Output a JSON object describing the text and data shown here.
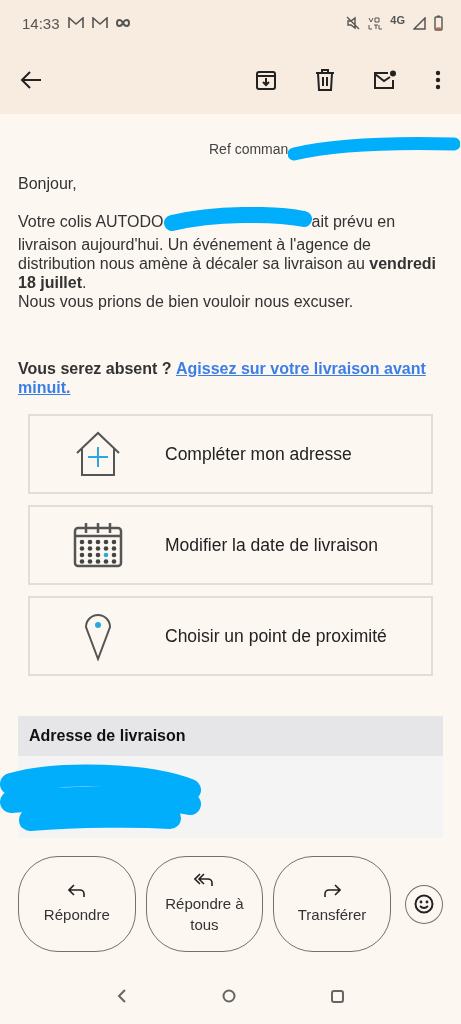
{
  "status_bar": {
    "time": "14:33",
    "network": "4G"
  },
  "body": {
    "reference": "Ref comman",
    "greeting": "Bonjour,",
    "intro_start": "Votre colis AUTODO",
    "intro_mid": "ait prévu en",
    "intro_end": "livraison aujourd'hui. Un événement à l'agence de distribution nous amène à décaler sa livraison au **vendredi 18 juillet**.",
    "apology": "Nous vous prions de bien vouloir nous excuser.",
    "absent_question": "Vous serez absent ?",
    "absent_link_lines": [
      "Agissez sur votre livraison avant",
      "minuit."
    ]
  },
  "actions": [
    {
      "kind": "house",
      "label": "Compléter mon adresse"
    },
    {
      "kind": "calendar",
      "label": "Modifier la date de livraison"
    },
    {
      "kind": "pin",
      "label": "Choisir un point de proximité"
    }
  ],
  "address_section": {
    "title": "Adresse de livraison"
  },
  "reply_buttons": [
    {
      "kind": "reply",
      "label": "Répondre"
    },
    {
      "kind": "reply_all",
      "label": "Répondre à tous"
    },
    {
      "kind": "forward",
      "label": "Transférer"
    }
  ]
}
